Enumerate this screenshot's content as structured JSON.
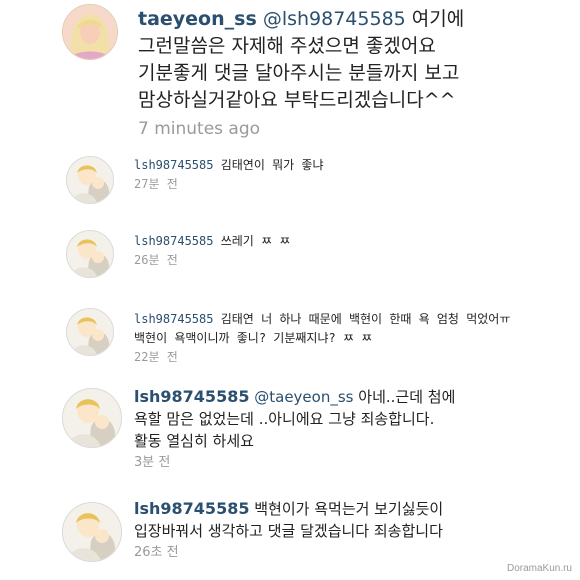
{
  "comments": [
    {
      "username": "taeyeon_ss",
      "mention": "@lsh98745585",
      "text_lines": [
        "여기에",
        "그런말씀은 자제해 주셨으면 좋겠어요",
        "기분좋게 댓글 달아주시는 분들까지 보고",
        "맘상하실거같아요 부탁드리겠습니다^^"
      ],
      "time": "7 minutes ago",
      "avatar_icon": "blonde-avatar-icon"
    },
    {
      "username": "lsh98745585",
      "text": "김태연이 뭐가 좋냐",
      "time": "27분 전",
      "avatar_icon": "cartoon-avatar-icon"
    },
    {
      "username": "lsh98745585",
      "text": "쓰레기 ㅉ ㅉ",
      "time": "26분 전",
      "avatar_icon": "cartoon-avatar-icon"
    },
    {
      "username": "lsh98745585",
      "text_lines": [
        "김태연 너 하나 때문에 백현이 한때 욕 엄청 먹었어ㅠ",
        "백현이 욕맥이니까 좋니? 기분째지냐? ㅉ ㅉ"
      ],
      "time": "22분 전",
      "avatar_icon": "cartoon-avatar-icon"
    },
    {
      "username": "lsh98745585",
      "mention": "@taeyeon_ss",
      "text_lines": [
        "아네..근데 첨에",
        "욕할 맘은 없었는데 ..아니에요 그냥 죄송합니다.",
        "활동 열심히 하세요"
      ],
      "time": "3분 전",
      "avatar_icon": "cartoon-avatar-icon"
    },
    {
      "username": "lsh98745585",
      "text_lines": [
        "백현이가 욕먹는거 보기싫듯이",
        "입장바꿔서 생각하고 댓글 달겠습니다 죄송합니다"
      ],
      "time": "26초 전",
      "avatar_icon": "cartoon-avatar-icon"
    }
  ],
  "watermark": "DoramaKun.ru",
  "colors": {
    "username": "#2a4f6f",
    "text": "#222222",
    "time": "#9a9a9a",
    "background": "#ffffff"
  }
}
